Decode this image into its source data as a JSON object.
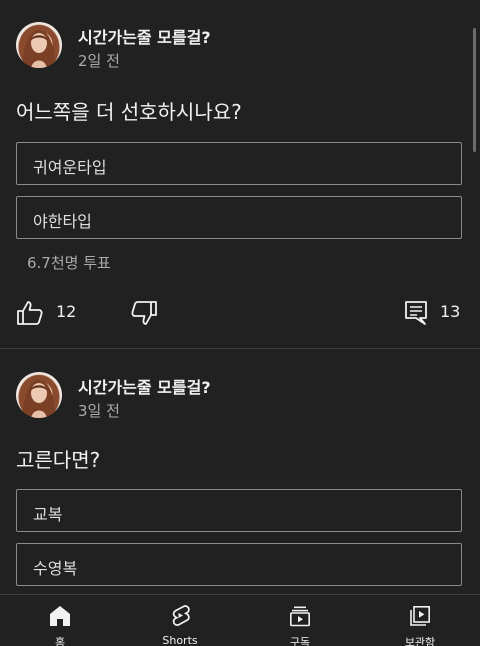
{
  "posts": [
    {
      "channel": "시간가는줄 모를걸?",
      "time": "2일 전",
      "question": "어느쪽을 더 선호하시나요?",
      "options": [
        "귀여운타입",
        "야한타입"
      ],
      "votes": "6.7천명 투표",
      "likes": "12",
      "comments": "13"
    },
    {
      "channel": "시간가는줄 모를걸?",
      "time": "3일 전",
      "question": "고른다면?",
      "options": [
        "교복",
        "수영복"
      ]
    }
  ],
  "nav": [
    {
      "label": "홈",
      "icon": "home-icon",
      "active": true
    },
    {
      "label": "Shorts",
      "icon": "shorts-icon"
    },
    {
      "label": "구독",
      "icon": "subscriptions-icon"
    },
    {
      "label": "보관함",
      "icon": "library-icon"
    }
  ],
  "colors": {
    "background": "#212121",
    "text": "#f1f1f1",
    "secondary": "#aaaaaa",
    "border": "#8a8a8a"
  }
}
